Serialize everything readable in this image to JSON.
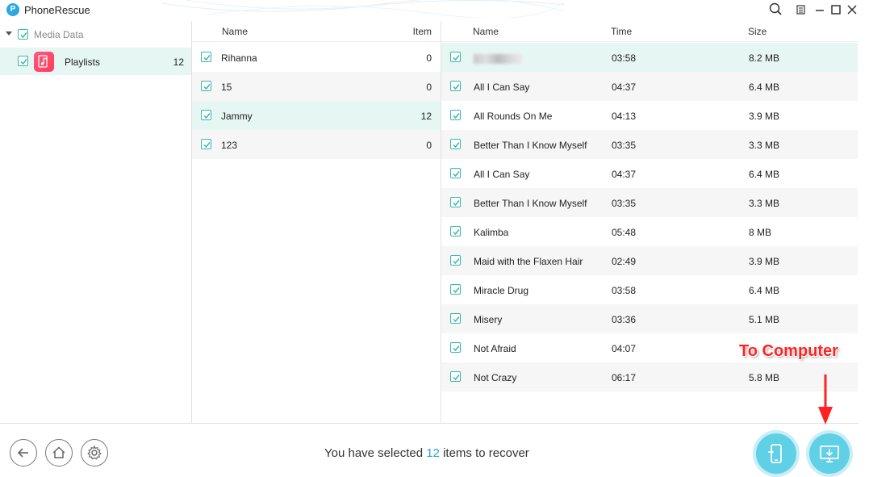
{
  "app": {
    "title": "PhoneRescue",
    "logo_letter": "P"
  },
  "sidebar": {
    "category": {
      "label": "Media Data"
    },
    "items": [
      {
        "label": "Playlists",
        "count": "12"
      }
    ]
  },
  "playlists_table": {
    "headers": {
      "name": "Name",
      "item": "Item"
    },
    "rows": [
      {
        "name": "Rihanna",
        "item": "0"
      },
      {
        "name": "15",
        "item": "0"
      },
      {
        "name": "Jammy",
        "item": "12"
      },
      {
        "name": "123",
        "item": "0"
      }
    ]
  },
  "songs_table": {
    "headers": {
      "name": "Name",
      "time": "Time",
      "size": "Size"
    },
    "rows": [
      {
        "name": "",
        "time": "03:58",
        "size": "8.2 MB"
      },
      {
        "name": "All I Can Say",
        "time": "04:37",
        "size": "6.4 MB"
      },
      {
        "name": "All Rounds On Me",
        "time": "04:13",
        "size": "3.9 MB"
      },
      {
        "name": "Better Than I Know Myself",
        "time": "03:35",
        "size": "3.3 MB"
      },
      {
        "name": "All I Can Say",
        "time": "04:37",
        "size": "6.4 MB"
      },
      {
        "name": "Better Than I Know Myself",
        "time": "03:35",
        "size": "3.3 MB"
      },
      {
        "name": "Kalimba",
        "time": "05:48",
        "size": "8 MB"
      },
      {
        "name": "Maid with the Flaxen Hair",
        "time": "02:49",
        "size": "3.9 MB"
      },
      {
        "name": "Miracle Drug",
        "time": "03:58",
        "size": "6.4 MB"
      },
      {
        "name": "Misery",
        "time": "03:36",
        "size": "5.1 MB"
      },
      {
        "name": "Not Afraid",
        "time": "04:07",
        "size": ""
      },
      {
        "name": "Not Crazy",
        "time": "06:17",
        "size": "5.8 MB"
      }
    ]
  },
  "footer": {
    "status_prefix": "You have selected",
    "status_count": "12",
    "status_suffix": "items to recover"
  },
  "annotation": {
    "label": "To Computer"
  },
  "colors": {
    "accent": "#36b8a7",
    "selected_row": "#e6f6f3",
    "action_button": "#5fd0e6",
    "annotation": "#ff2222"
  }
}
